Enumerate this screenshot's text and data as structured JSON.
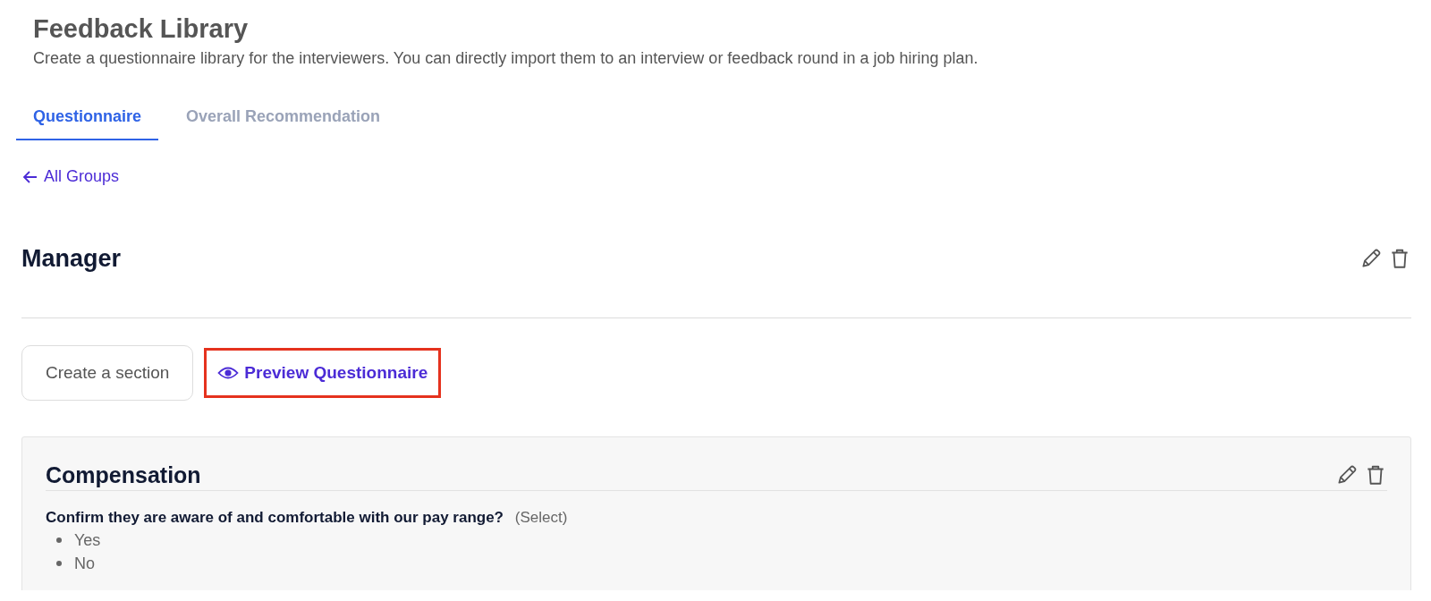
{
  "header": {
    "title": "Feedback Library",
    "subtitle": "Create a questionnaire library for the interviewers. You can directly import them to an interview or feedback round in a job hiring plan."
  },
  "tabs": [
    {
      "label": "Questionnaire",
      "selected": true
    },
    {
      "label": "Overall Recommendation",
      "selected": false
    }
  ],
  "back_link": {
    "label": "All Groups"
  },
  "group": {
    "title": "Manager"
  },
  "actions": {
    "create_button": "Create a section",
    "preview_link": {
      "label": "Preview Questionnaire",
      "highlighted": true
    }
  },
  "sections": [
    {
      "title": "Compensation",
      "questions": [
        {
          "text": "Confirm they are aware of and comfortable with our pay range?",
          "type_label": "(Select)",
          "options": [
            "Yes",
            "No"
          ]
        }
      ]
    }
  ]
}
